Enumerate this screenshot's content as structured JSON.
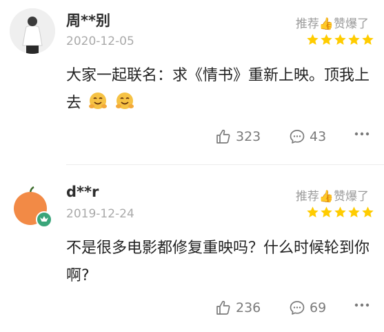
{
  "comments": [
    {
      "username": "周**别",
      "date": "2020-12-05",
      "rating_label": "推荐👍赞爆了",
      "stars": 5,
      "text": "大家一起联名：求《情书》重新上映。顶我上去",
      "emojis": [
        "hug-emoji",
        "hug-emoji"
      ],
      "likes": "323",
      "replies": "43"
    },
    {
      "username": "d**r",
      "date": "2019-12-24",
      "rating_label": "推荐👍赞爆了",
      "stars": 5,
      "text": "不是很多电影都修复重映吗？什么时候轮到你啊?",
      "likes": "236",
      "replies": "69"
    }
  ],
  "colors": {
    "star": "#ffcc00",
    "badge": "#3aa57a",
    "apple": "#f28a46"
  }
}
